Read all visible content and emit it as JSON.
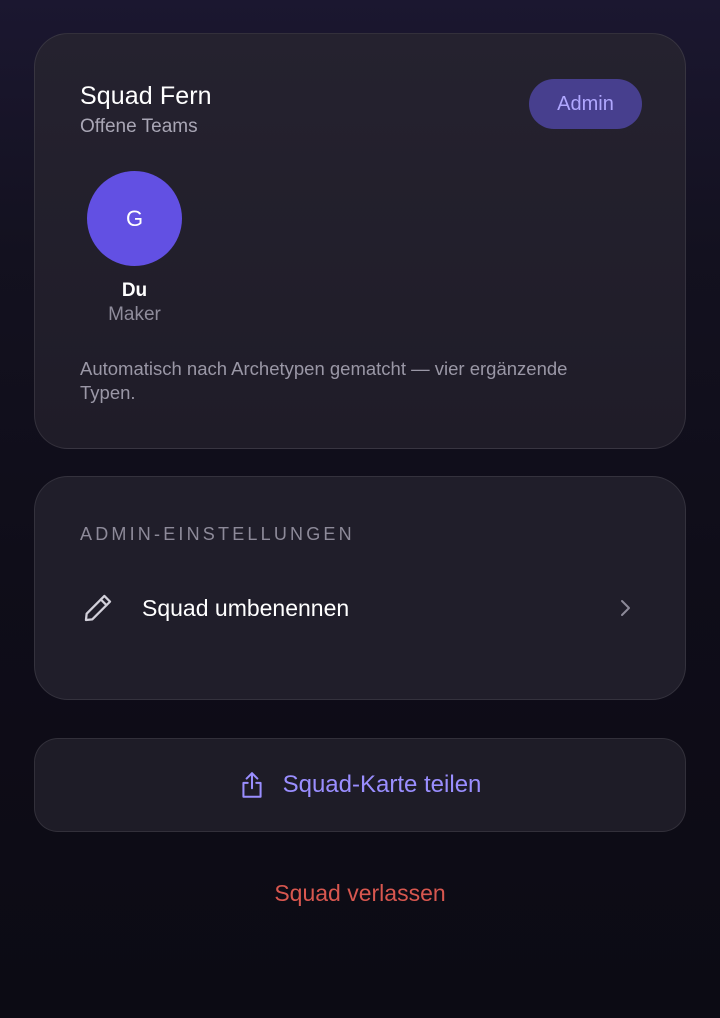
{
  "squad": {
    "name": "Squad Fern",
    "subtitle": "Offene Teams",
    "role_badge": "Admin",
    "members": [
      {
        "initial": "G",
        "name": "Du",
        "archetype": "Maker"
      }
    ],
    "match_note": "Automatisch nach Archetypen gematcht — vier ergänzende Typen."
  },
  "admin_settings": {
    "section_label": "ADMIN-EINSTELLUNGEN",
    "items": [
      {
        "label": "Squad umbenennen",
        "icon": "pencil-icon"
      }
    ]
  },
  "actions": {
    "share_label": "Squad-Karte teilen",
    "share_icon": "share-icon",
    "leave_label": "Squad verlassen"
  },
  "colors": {
    "accent": "#6250e3",
    "accent_text": "#9a8eff",
    "danger": "#d8574f"
  }
}
